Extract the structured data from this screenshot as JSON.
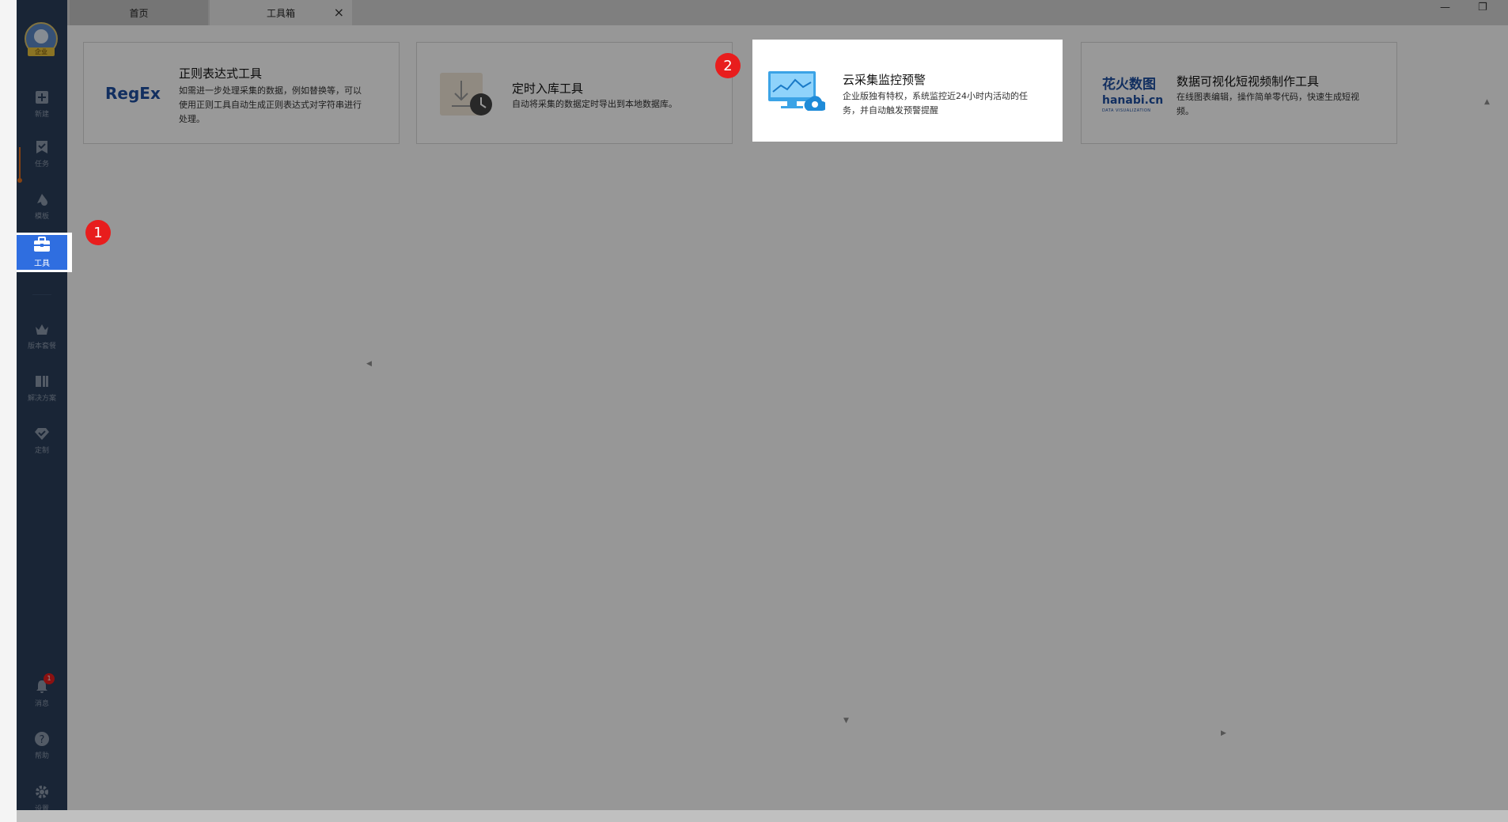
{
  "tabs": [
    {
      "label": "首页"
    },
    {
      "label": "工具箱",
      "close": "×"
    }
  ],
  "window_controls": {
    "minimize": "—",
    "restore": "❐"
  },
  "sidebar": {
    "avatar_badge": "企业",
    "items": [
      {
        "label": "新建",
        "icon": "plus-square-icon"
      },
      {
        "label": "任务",
        "icon": "task-icon"
      },
      {
        "label": "模板",
        "icon": "template-icon"
      },
      {
        "label": "工具",
        "icon": "toolbox-icon",
        "active": true
      },
      {
        "label": "版本套餐",
        "icon": "crown-icon"
      },
      {
        "label": "解决方案",
        "icon": "solution-icon"
      },
      {
        "label": "定制",
        "icon": "custom-icon"
      },
      {
        "label": "消息",
        "icon": "bell-icon",
        "badge": "1"
      },
      {
        "label": "帮助",
        "icon": "help-icon"
      },
      {
        "label": "设置",
        "icon": "gear-icon"
      }
    ]
  },
  "cards": [
    {
      "logo": "RegEx",
      "title": "正则表达式工具",
      "desc": "如需进一步处理采集的数据，例如替换等，可以使用正则工具自动生成正则表达式对字符串进行处理。"
    },
    {
      "title": "定时入库工具",
      "desc": "自动将采集的数据定时导出到本地数据库。"
    },
    {
      "title": "云采集监控预警",
      "desc": "企业版独有特权，系统监控近24小时内活动的任务，并自动触发预警提醒"
    },
    {
      "logo": "花火数图",
      "logo_sub": "hanabi.cn",
      "logo_caption": "DATA VISUALIZATION",
      "title": "数据可视化短视频制作工具",
      "desc": "在线图表编辑，操作简单零代码，快速生成短视频。"
    }
  ],
  "step_markers": [
    "1",
    "2"
  ],
  "colors": {
    "sidebar": "#2a3e5a",
    "active": "#2f6ee0",
    "badge": "#e81d1d",
    "regex_logo": "#1e4fa0"
  }
}
